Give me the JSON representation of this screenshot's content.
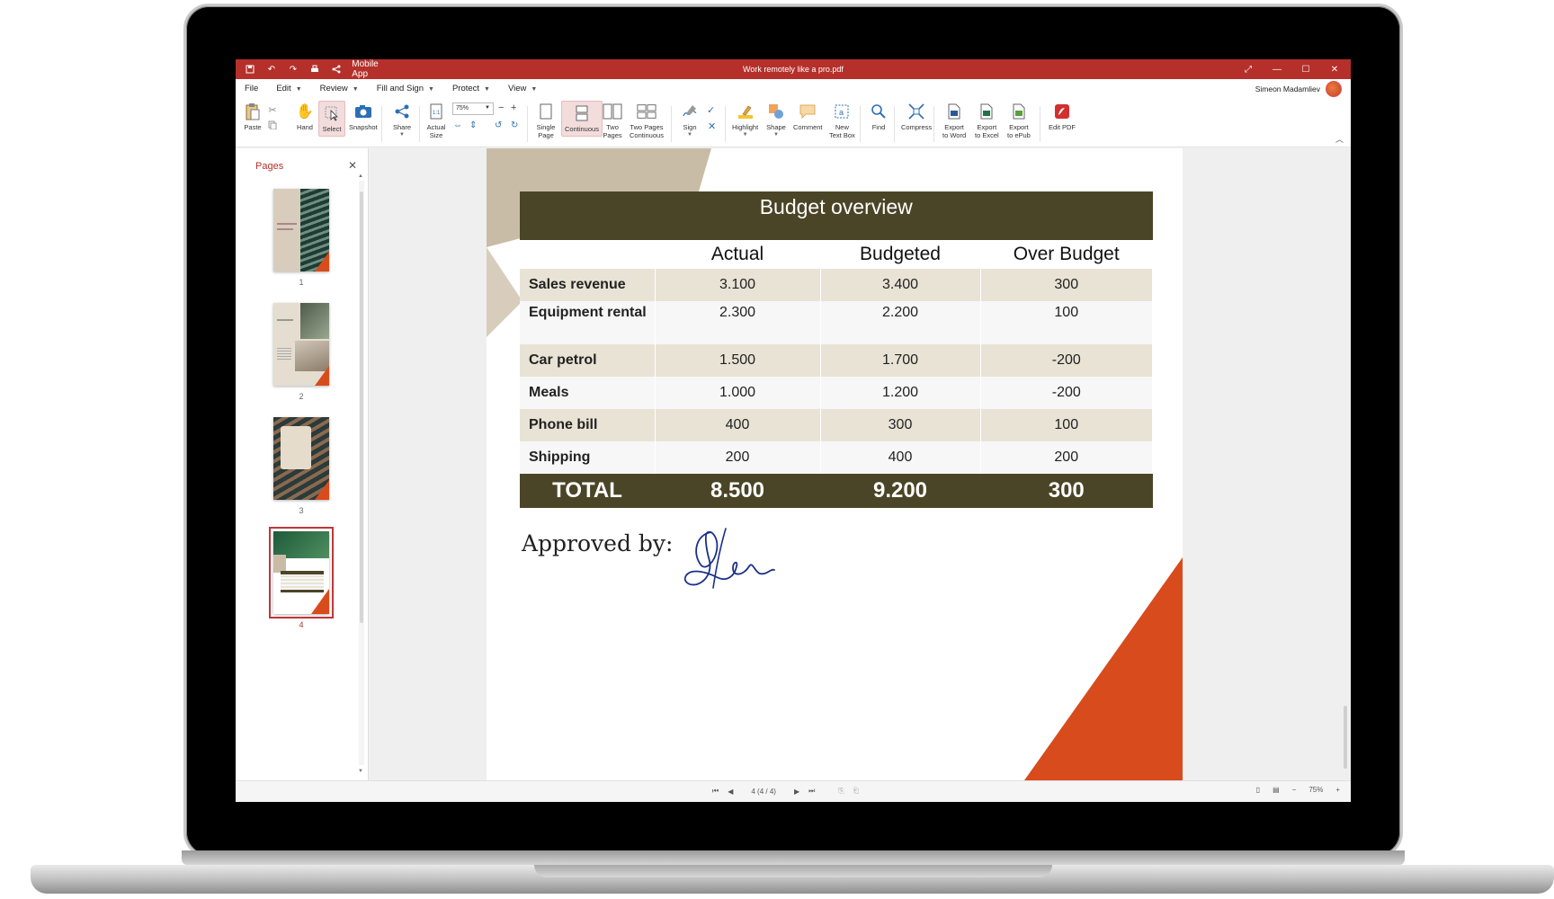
{
  "app": {
    "title": "Work remotely like a pro.pdf",
    "mobile_app_label": "Mobile App",
    "accent": "#b5302b"
  },
  "menu": {
    "items": [
      "File",
      "Edit",
      "Review",
      "Fill and Sign",
      "Protect",
      "View"
    ],
    "user_name": "Simeon Madamliev"
  },
  "toolbar": {
    "paste": "Paste",
    "hand": "Hand",
    "select": "Select",
    "snapshot": "Snapshot",
    "share": "Share",
    "actual_size": "Actual\nSize",
    "zoom_value": "75%",
    "single_page": "Single\nPage",
    "continuous": "Continuous",
    "two_pages": "Two\nPages",
    "two_pages_continuous": "Two Pages\nContinuous",
    "sign": "Sign",
    "highlight": "Highlight",
    "shape": "Shape",
    "comment": "Comment",
    "new_text_box": "New\nText Box",
    "find": "Find",
    "compress": "Compress",
    "export_word": "Export\nto Word",
    "export_excel": "Export\nto Excel",
    "export_epub": "Export\nto ePub",
    "edit_pdf": "Edit PDF"
  },
  "pages_panel": {
    "header": "Pages",
    "thumbnails": [
      {
        "num": "1"
      },
      {
        "num": "2"
      },
      {
        "num": "3"
      },
      {
        "num": "4"
      }
    ],
    "selected": 4
  },
  "document": {
    "table_title": "Budget overview",
    "columns": [
      "",
      "Actual",
      "Budgeted",
      "Over Budget"
    ],
    "rows": [
      {
        "label": "Sales revenue",
        "actual": "3.100",
        "budgeted": "3.400",
        "over": "300"
      },
      {
        "label": "Equipment rental",
        "actual": "2.300",
        "budgeted": "2.200",
        "over": "100"
      },
      {
        "label": "Car petrol",
        "actual": "1.500",
        "budgeted": "1.700",
        "over": "-200"
      },
      {
        "label": "Meals",
        "actual": "1.000",
        "budgeted": "1.200",
        "over": "-200"
      },
      {
        "label": "Phone bill",
        "actual": "400",
        "budgeted": "300",
        "over": "100"
      },
      {
        "label": "Shipping",
        "actual": "200",
        "budgeted": "400",
        "over": "200"
      }
    ],
    "total": {
      "label": "TOTAL",
      "actual": "8.500",
      "budgeted": "9.200",
      "over": "300"
    },
    "approved_by": "Approved by:"
  },
  "status": {
    "page_indicator": "4 (4 / 4)",
    "zoom": "75%"
  }
}
